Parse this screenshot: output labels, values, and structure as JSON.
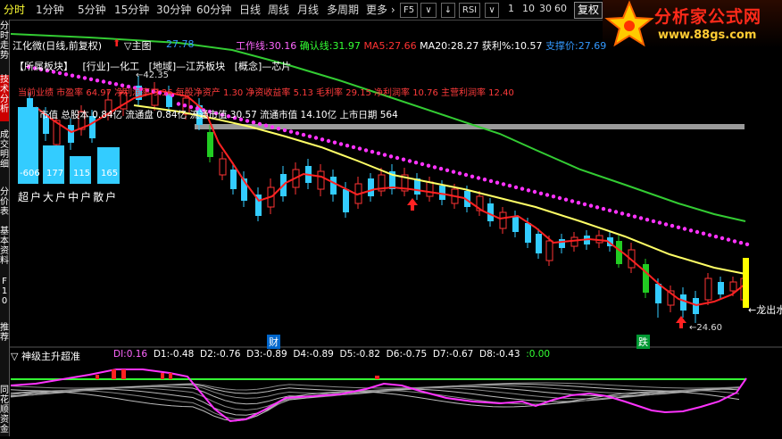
{
  "toolbar": {
    "tabs": [
      {
        "label": "分时",
        "active": true
      },
      {
        "label": "1分钟"
      },
      {
        "label": "5分钟"
      },
      {
        "label": "15分钟"
      },
      {
        "label": "30分钟"
      },
      {
        "label": "60分钟"
      },
      {
        "label": "日线"
      },
      {
        "label": "周线"
      },
      {
        "label": "月线"
      },
      {
        "label": "多周期"
      },
      {
        "label": "更多 ›"
      }
    ],
    "icons": [
      "F5",
      "∨",
      "↓",
      "RSI",
      "∨",
      "1",
      "10",
      "30",
      "60"
    ],
    "fuquan": "复权"
  },
  "logo": {
    "main": "分析家公式网",
    "sub": "www.88gs.com"
  },
  "sidebar": [
    {
      "label": "分时走势"
    },
    {
      "label": "技术分析",
      "active": true
    },
    {
      "label": "成交明细"
    },
    {
      "label": "分价表"
    },
    {
      "label": "基本资料"
    },
    {
      "label": "F10"
    },
    {
      "label": "推荐"
    },
    {
      "label": "同花顺资金"
    }
  ],
  "header": {
    "stock_title": "江化微(日线,前复权)",
    "arrow_up": "⬆",
    "main_chart": "▽主图",
    "value1": "27.78",
    "indicators": [
      {
        "label": "工作线:",
        "value": "30.16",
        "color": "#ff66ff"
      },
      {
        "label": "确认线:",
        "value": "31.97",
        "color": "#33ff33"
      },
      {
        "label": "MA5:",
        "value": "27.66",
        "color": "#ff3333"
      },
      {
        "label": "MA20:",
        "value": "28.27",
        "color": "#ffffff"
      },
      {
        "label": "获利%:",
        "value": "10.57",
        "color": "#ffffff"
      },
      {
        "label": "支撑价:",
        "value": "27.69",
        "color": "#3399ff"
      }
    ]
  },
  "info": {
    "sectors": [
      "【所属板块】",
      "[行业]—化工",
      "[地域]—江苏板块",
      "[概念]—芯片"
    ],
    "finance": "当前业绩 市盈率 64.97 净利润率 9.36 每股净资产 1.30 净资收益率 5.13 毛利率 29.15 净利润率 10.76 主营利润率 12.40",
    "market": "市值 总股本 0.84亿 流通盘 0.84亿 流通市值 30.57 流通市值 14.10亿 上市日期 564",
    "price_high": "42.35",
    "price_low": "24.60",
    "dragon_out": "龙出水",
    "marker_cai": "财",
    "marker_die": "跌"
  },
  "flows": {
    "labels": [
      "超",
      "户",
      "大",
      "户",
      "中",
      "户",
      "散",
      "户"
    ],
    "values": [
      "-606",
      "177",
      "115",
      "165"
    ]
  },
  "sub": {
    "title": "▽ 神级主升超准",
    "params": [
      {
        "label": "DI:",
        "value": "0.16",
        "color": "#ff66ff"
      },
      {
        "label": "D1:",
        "value": "-0.48"
      },
      {
        "label": "D2:",
        "value": "-0.76"
      },
      {
        "label": "D3:",
        "value": "-0.89"
      },
      {
        "label": "D4:",
        "value": "-0.89"
      },
      {
        "label": "D5:",
        "value": "-0.82"
      },
      {
        "label": "D6:",
        "value": "-0.75"
      },
      {
        "label": "D7:",
        "value": "-0.67"
      },
      {
        "label": "D8:",
        "value": "-0.43"
      },
      {
        "label": ":",
        "value": "0.00",
        "color": "#33ff33"
      }
    ]
  },
  "colors": {
    "up": "#ff3333",
    "down": "#33ccff",
    "ma5": "#ff3333",
    "ma20": "#ffff66",
    "long": "#33cc33",
    "dots": "#ff33ff"
  }
}
